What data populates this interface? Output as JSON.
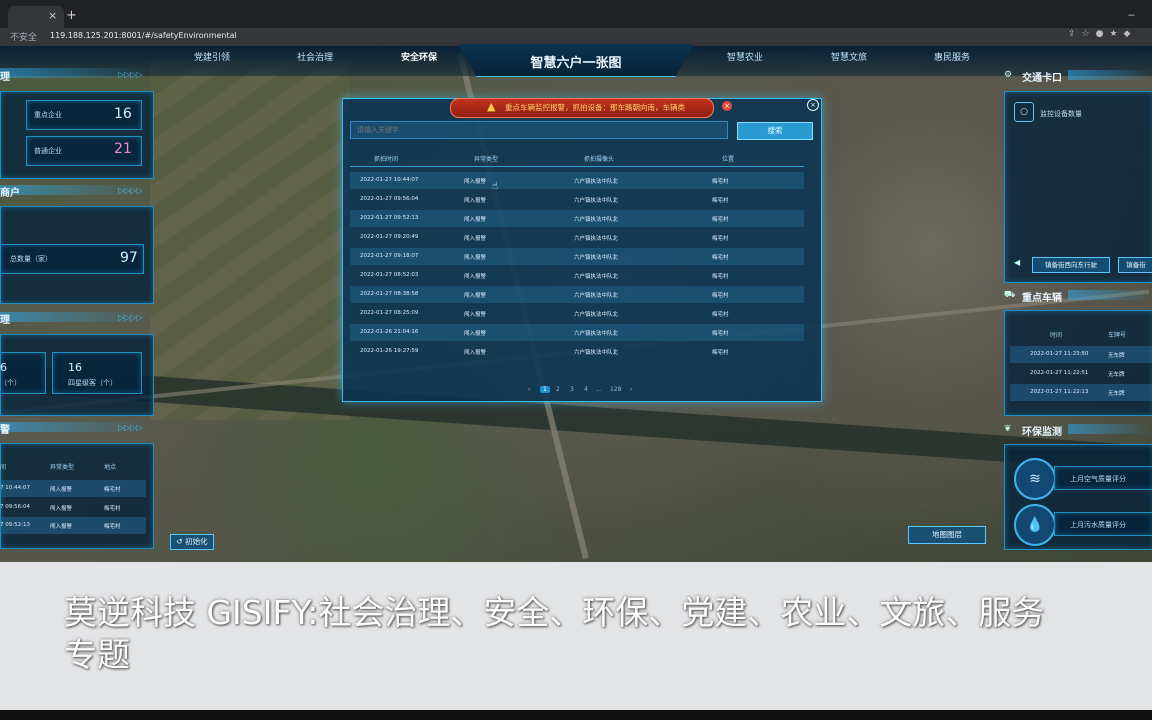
{
  "browser": {
    "tab_close": "×",
    "new_tab": "+",
    "minimize": "‒",
    "security_label": "不安全",
    "url": "119.188.125.201:8001/#/safetyEnvironmental"
  },
  "header": {
    "title": "智慧六户一张图",
    "nav": [
      "党建引领",
      "社会治理",
      "安全环保",
      "智慧农业",
      "智慧文旅",
      "惠民服务"
    ],
    "active_nav": "安全环保"
  },
  "left": {
    "sec1": {
      "title": "理",
      "items": [
        {
          "label": "重点企业",
          "value": "16"
        },
        {
          "label": "普通企业",
          "value": "21"
        }
      ]
    },
    "sec2": {
      "title": "商户",
      "total_label": "总数量（家）",
      "total_value": "97"
    },
    "sec3": {
      "title": "理",
      "cards": [
        {
          "value": "6",
          "label": "（个）"
        },
        {
          "value": "16",
          "label": "四星级客（个）"
        }
      ]
    },
    "sec4": {
      "title": "警",
      "headers": [
        "间",
        "异常类型",
        "地点"
      ],
      "rows": [
        [
          "7 10:44:07",
          "闯入报警",
          "梅宅村"
        ],
        [
          "7 09:56:04",
          "闯入报警",
          "梅宅村"
        ],
        [
          "7 09:52:13",
          "闯入报警",
          "梅宅村"
        ]
      ]
    },
    "reset_button": "初始化"
  },
  "right": {
    "traffic": {
      "title": "交通卡口",
      "monitor_label": "监控设备数量",
      "camera1": "镇备街西向东行驶",
      "camera2": "镇备街"
    },
    "vehicles": {
      "title": "重点车辆",
      "headers": [
        "时间",
        "车牌号"
      ],
      "rows": [
        [
          "2022-01-27 11:23:50",
          "无车牌"
        ],
        [
          "2022-01-27 11:22:51",
          "无车牌"
        ],
        [
          "2022-01-27 11:22:13",
          "无车牌"
        ]
      ]
    },
    "env": {
      "title": "环保监测",
      "air_label": "上月空气质量评分",
      "water_label": "上月污水质量评分"
    },
    "layers_button": "地图图层"
  },
  "modal": {
    "alert_text": "重点车辆监控报警，抓拍设备：那车路朝向南，车辆类",
    "search_placeholder": "请输入关键字",
    "search_button": "搜索",
    "headers": [
      "抓拍时间",
      "异常类型",
      "抓拍摄像头",
      "位置"
    ],
    "rows": [
      [
        "2022-01-27 10:44:07",
        "闯入报警",
        "六户镇执法中队北",
        "梅宅村"
      ],
      [
        "2022-01-27 09:56:04",
        "闯入报警",
        "六户镇执法中队北",
        "梅宅村"
      ],
      [
        "2022-01-27 09:52:13",
        "闯入报警",
        "六户镇执法中队北",
        "梅宅村"
      ],
      [
        "2022-01-27 09:20:49",
        "闯入报警",
        "六户镇执法中队北",
        "梅宅村"
      ],
      [
        "2022-01-27 09:18:07",
        "闯入报警",
        "六户镇执法中队北",
        "梅宅村"
      ],
      [
        "2022-01-27 08:52:03",
        "闯入报警",
        "六户镇执法中队北",
        "梅宅村"
      ],
      [
        "2022-01-27 08:38:58",
        "闯入报警",
        "六户镇执法中队北",
        "梅宅村"
      ],
      [
        "2022-01-27 08:25:09",
        "闯入报警",
        "六户镇执法中队北",
        "梅宅村"
      ],
      [
        "2022-01-26 21:04:16",
        "闯入报警",
        "六户镇执法中队北",
        "梅宅村"
      ],
      [
        "2022-01-26 19:27:59",
        "闯入报警",
        "六户镇执法中队北",
        "梅宅村"
      ]
    ],
    "pagination": {
      "prev": "‹",
      "pages": [
        "1",
        "2",
        "3",
        "4",
        "...",
        "128"
      ],
      "next": "›",
      "current": "1"
    }
  },
  "caption": "莫逆科技 GISIFY:社会治理、安全、环保、党建、农业、文旅、服务专题"
}
